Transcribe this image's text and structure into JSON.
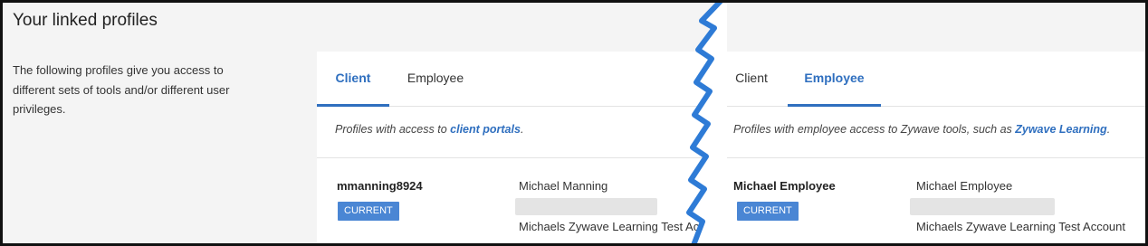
{
  "page": {
    "title": "Your linked profiles",
    "intro": "The following profiles give you access to different sets of tools and/or different user privileges."
  },
  "left_panel": {
    "tabs": [
      {
        "label": "Client",
        "active": true
      },
      {
        "label": "Employee",
        "active": false
      }
    ],
    "description_prefix": "Profiles with access to ",
    "description_link": "client portals",
    "description_suffix": ".",
    "profile": {
      "username": "mmanning8924",
      "badge": "CURRENT",
      "full_name": "Michael Manning",
      "account": "Michaels Zywave Learning Test Acco"
    }
  },
  "right_panel": {
    "tabs": [
      {
        "label": "Client",
        "active": false
      },
      {
        "label": "Employee",
        "active": true
      }
    ],
    "description_prefix": "Profiles with employee access to Zywave tools, such as ",
    "description_link": "Zywave Learning",
    "description_suffix": ".",
    "profile": {
      "username": "Michael Employee",
      "badge": "CURRENT",
      "full_name": "Michael Employee",
      "account": "Michaels Zywave Learning Test Account"
    }
  },
  "colors": {
    "accent": "#2f6fbf",
    "badge": "#4a86d4",
    "tear": "#2e7bd6"
  }
}
